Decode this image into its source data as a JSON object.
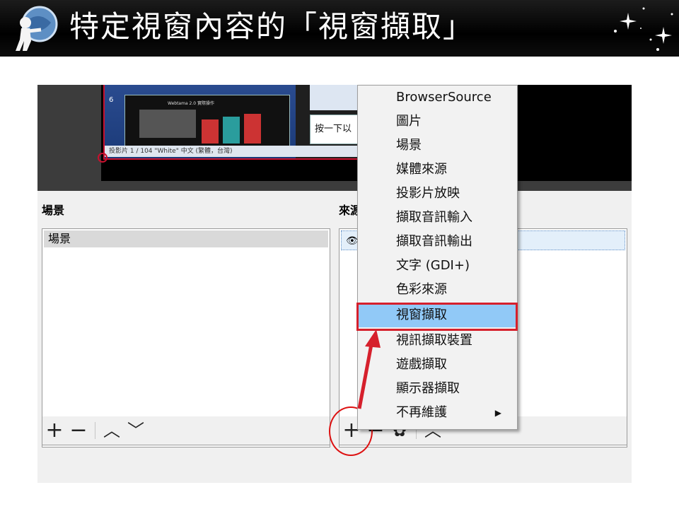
{
  "slide": {
    "title": "特定視窗內容的「視窗擷取」"
  },
  "preview": {
    "slide_number": "6",
    "thumb_title": "Webtama 2.0 實際操作",
    "notes_text": "按一下以",
    "status_bar": "投影片 1 / 104   \"White\"   中文 (繁體，台灣)"
  },
  "scenes_panel": {
    "label": "場景",
    "items": [
      "場景"
    ]
  },
  "sources_panel": {
    "label": "來源"
  },
  "context_menu": {
    "items": [
      {
        "label": "BrowserSource"
      },
      {
        "label": "圖片"
      },
      {
        "label": "場景"
      },
      {
        "label": "媒體來源"
      },
      {
        "label": "投影片放映"
      },
      {
        "label": "擷取音訊輸入"
      },
      {
        "label": "擷取音訊輸出"
      },
      {
        "label": "文字 (GDI+)"
      },
      {
        "label": "色彩來源"
      },
      {
        "label": "視窗擷取",
        "highlighted": true
      },
      {
        "label": "視訊擷取裝置"
      },
      {
        "label": "遊戲擷取"
      },
      {
        "label": "顯示器擷取"
      },
      {
        "label": "不再維護",
        "submenu": true
      }
    ]
  },
  "toolbar": {
    "add": "+",
    "remove": "−",
    "up": "︿",
    "down": "﹀",
    "settings": "✿"
  },
  "colors": {
    "highlight": "#91c9f7",
    "annotation_red": "#d6202c"
  }
}
